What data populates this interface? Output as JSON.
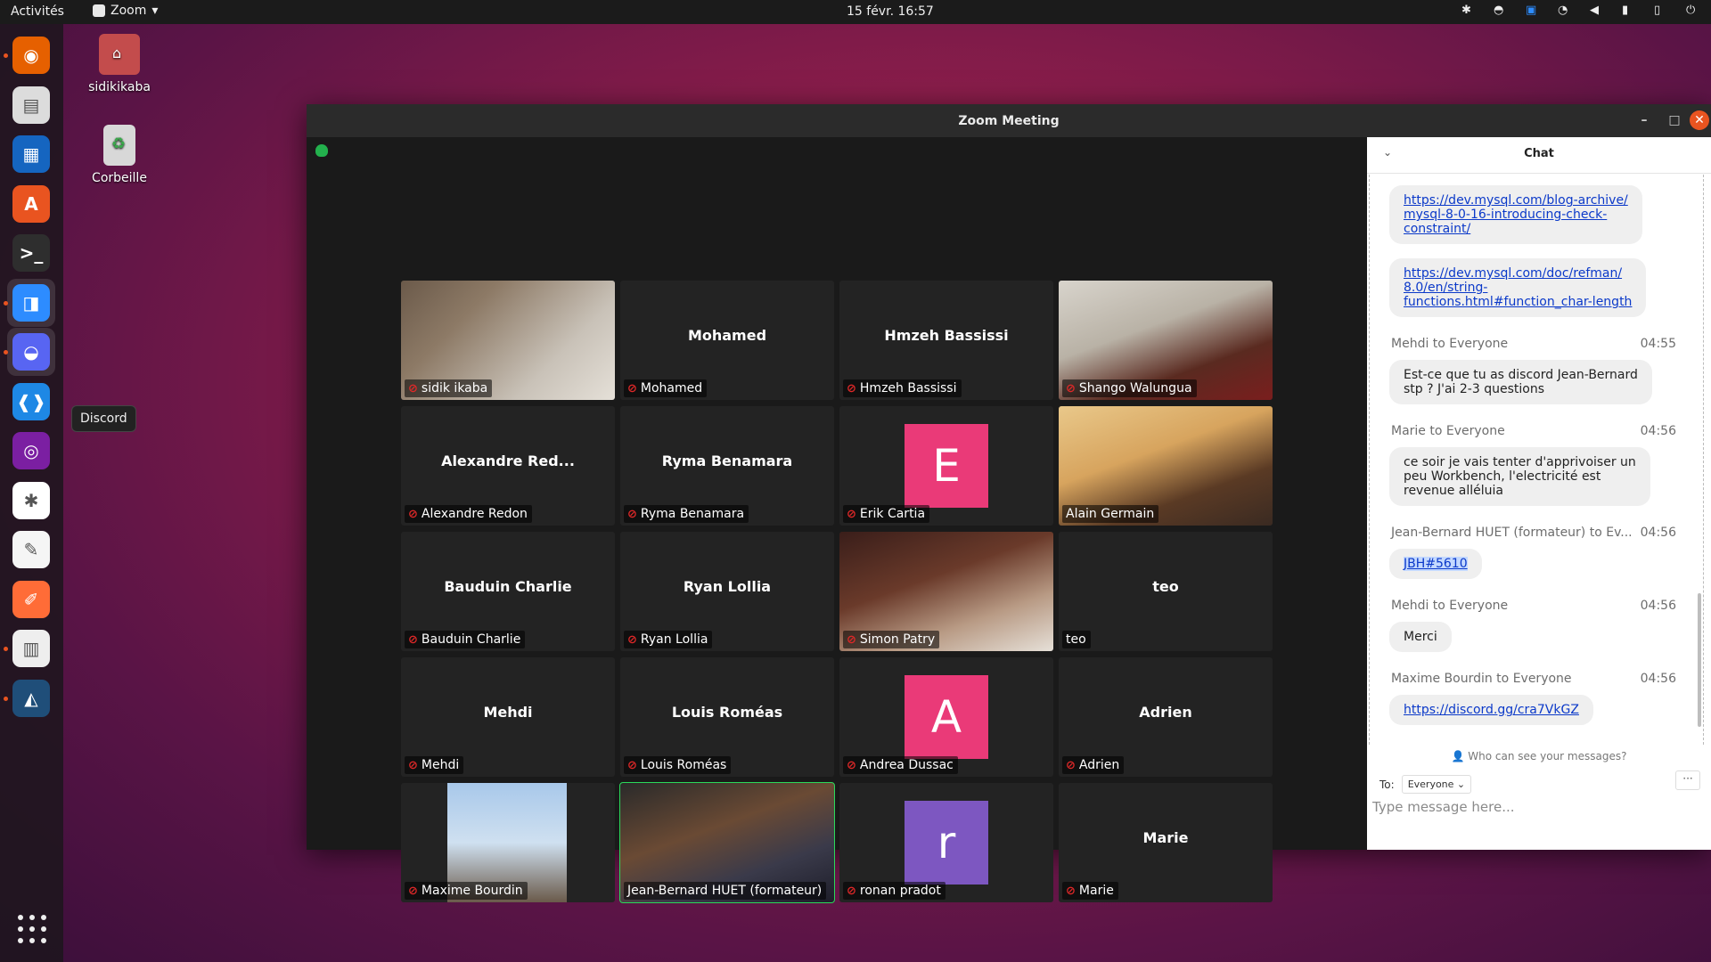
{
  "topbar": {
    "activities": "Activités",
    "app_name": "Zoom",
    "clock": "15 févr.  16:57",
    "tray_icons": [
      "slack-tray-icon",
      "discord-tray-icon",
      "zoom-tray-icon",
      "wifi-icon",
      "volume-icon",
      "mic-icon",
      "battery-icon",
      "power-icon"
    ]
  },
  "dock": {
    "items": [
      {
        "name": "firefox",
        "color": "#e66000",
        "running": true
      },
      {
        "name": "files",
        "color": "#dcdcdc",
        "running": false
      },
      {
        "name": "libreoffice-writer",
        "color": "#1565c0",
        "running": false
      },
      {
        "name": "ubuntu-software",
        "color": "#e95420",
        "running": false
      },
      {
        "name": "terminal",
        "color": "#2e2e2e",
        "running": false
      },
      {
        "name": "zoom",
        "color": "#2d8cff",
        "running": true
      },
      {
        "name": "discord",
        "color": "#5865f2",
        "running": true
      },
      {
        "name": "vscode",
        "color": "#1e88e5",
        "running": false
      },
      {
        "name": "video-recorder",
        "color": "#7b1fa2",
        "running": false
      },
      {
        "name": "slack",
        "color": "#ffffff",
        "running": false
      },
      {
        "name": "text-editor",
        "color": "#f5f5f5",
        "running": false
      },
      {
        "name": "postman",
        "color": "#ff6c37",
        "running": false
      },
      {
        "name": "document-viewer",
        "color": "#eeeeee",
        "running": true
      },
      {
        "name": "mysql-workbench",
        "color": "#1f4e79",
        "running": true
      }
    ],
    "tooltip": "Discord",
    "show_apps": "show-apps-icon"
  },
  "desktop": {
    "home_label": "sidikikaba",
    "trash_label": "Corbeille"
  },
  "window": {
    "title": "Zoom Meeting"
  },
  "participants": [
    {
      "name": "sidik ikaba",
      "center": "",
      "type": "video",
      "muted": true
    },
    {
      "name": "Mohamed",
      "center": "Mohamed",
      "type": "name",
      "muted": true
    },
    {
      "name": "Hmzeh Bassissi",
      "center": "Hmzeh Bassissi",
      "type": "name",
      "muted": true
    },
    {
      "name": "Shango Walungua",
      "center": "",
      "type": "video",
      "muted": true
    },
    {
      "name": "Alexandre Redon",
      "center": "Alexandre Red...",
      "type": "name",
      "muted": true
    },
    {
      "name": "Ryma Benamara",
      "center": "Ryma Benamara",
      "type": "name",
      "muted": true
    },
    {
      "name": "Erik Cartia",
      "center": "",
      "type": "avatar",
      "letter": "E",
      "avatar_color": "#ea3a78",
      "muted": true
    },
    {
      "name": "Alain Germain",
      "center": "",
      "type": "video",
      "muted": false
    },
    {
      "name": "Bauduin Charlie",
      "center": "Bauduin Charlie",
      "type": "name",
      "muted": true
    },
    {
      "name": "Ryan Lollia",
      "center": "Ryan Lollia",
      "type": "name",
      "muted": true
    },
    {
      "name": "Simon Patry",
      "center": "",
      "type": "video",
      "muted": true
    },
    {
      "name": "teo",
      "center": "teo",
      "type": "name",
      "muted": false
    },
    {
      "name": "Mehdi",
      "center": "Mehdi",
      "type": "name",
      "muted": true
    },
    {
      "name": "Louis Roméas",
      "center": "Louis Roméas",
      "type": "name",
      "muted": true
    },
    {
      "name": "Andrea Dussac",
      "center": "",
      "type": "avatar",
      "letter": "A",
      "avatar_color": "#ea3a78",
      "muted": true
    },
    {
      "name": "Adrien",
      "center": "Adrien",
      "type": "name",
      "muted": true
    },
    {
      "name": "Maxime Bourdin",
      "center": "",
      "type": "video",
      "muted": true
    },
    {
      "name": "Jean-Bernard HUET (formateur)",
      "center": "",
      "type": "video",
      "muted": false,
      "speaking": true
    },
    {
      "name": "ronan pradot",
      "center": "",
      "type": "avatar",
      "letter": "r",
      "avatar_color": "#7d57c1",
      "muted": true
    },
    {
      "name": "Marie",
      "center": "Marie",
      "type": "name",
      "muted": true
    }
  ],
  "chat": {
    "title": "Chat",
    "messages": [
      {
        "sender": "",
        "time": "",
        "lines": [
          "https://dev.mysql.com/blog-archive/",
          "mysql-8-0-16-introducing-check-",
          "constraint/"
        ],
        "link": true
      },
      {
        "sender": "",
        "time": "",
        "lines": [
          "https://dev.mysql.com/doc/refman/",
          "8.0/en/string-",
          "functions.html#function_char-length"
        ],
        "link": true
      },
      {
        "sender": "Mehdi to Everyone",
        "time": "04:55",
        "lines": [
          "Est-ce que tu as discord Jean-Bernard",
          "stp ? J'ai 2-3 questions"
        ],
        "link": false
      },
      {
        "sender": "Marie to Everyone",
        "time": "04:56",
        "lines": [
          "ce soir je vais tenter d'apprivoiser un",
          "peu Workbench, l'electricité est",
          "revenue alléluia"
        ],
        "link": false
      },
      {
        "sender": "Jean-Bernard HUET (formateur) to Ev...",
        "time": "04:56",
        "lines": [
          "JBH#5610"
        ],
        "link": false,
        "selected": true
      },
      {
        "sender": "Mehdi to Everyone",
        "time": "04:56",
        "lines": [
          "Merci"
        ],
        "link": false
      },
      {
        "sender": "Maxime Bourdin to Everyone",
        "time": "04:56",
        "lines": [
          "https://discord.gg/cra7VkGZ"
        ],
        "link": true
      }
    ],
    "who_can_see": "Who can see your messages?",
    "to_label": "To:",
    "to_value": "Everyone",
    "more": "···",
    "input_placeholder": "Type message here..."
  }
}
